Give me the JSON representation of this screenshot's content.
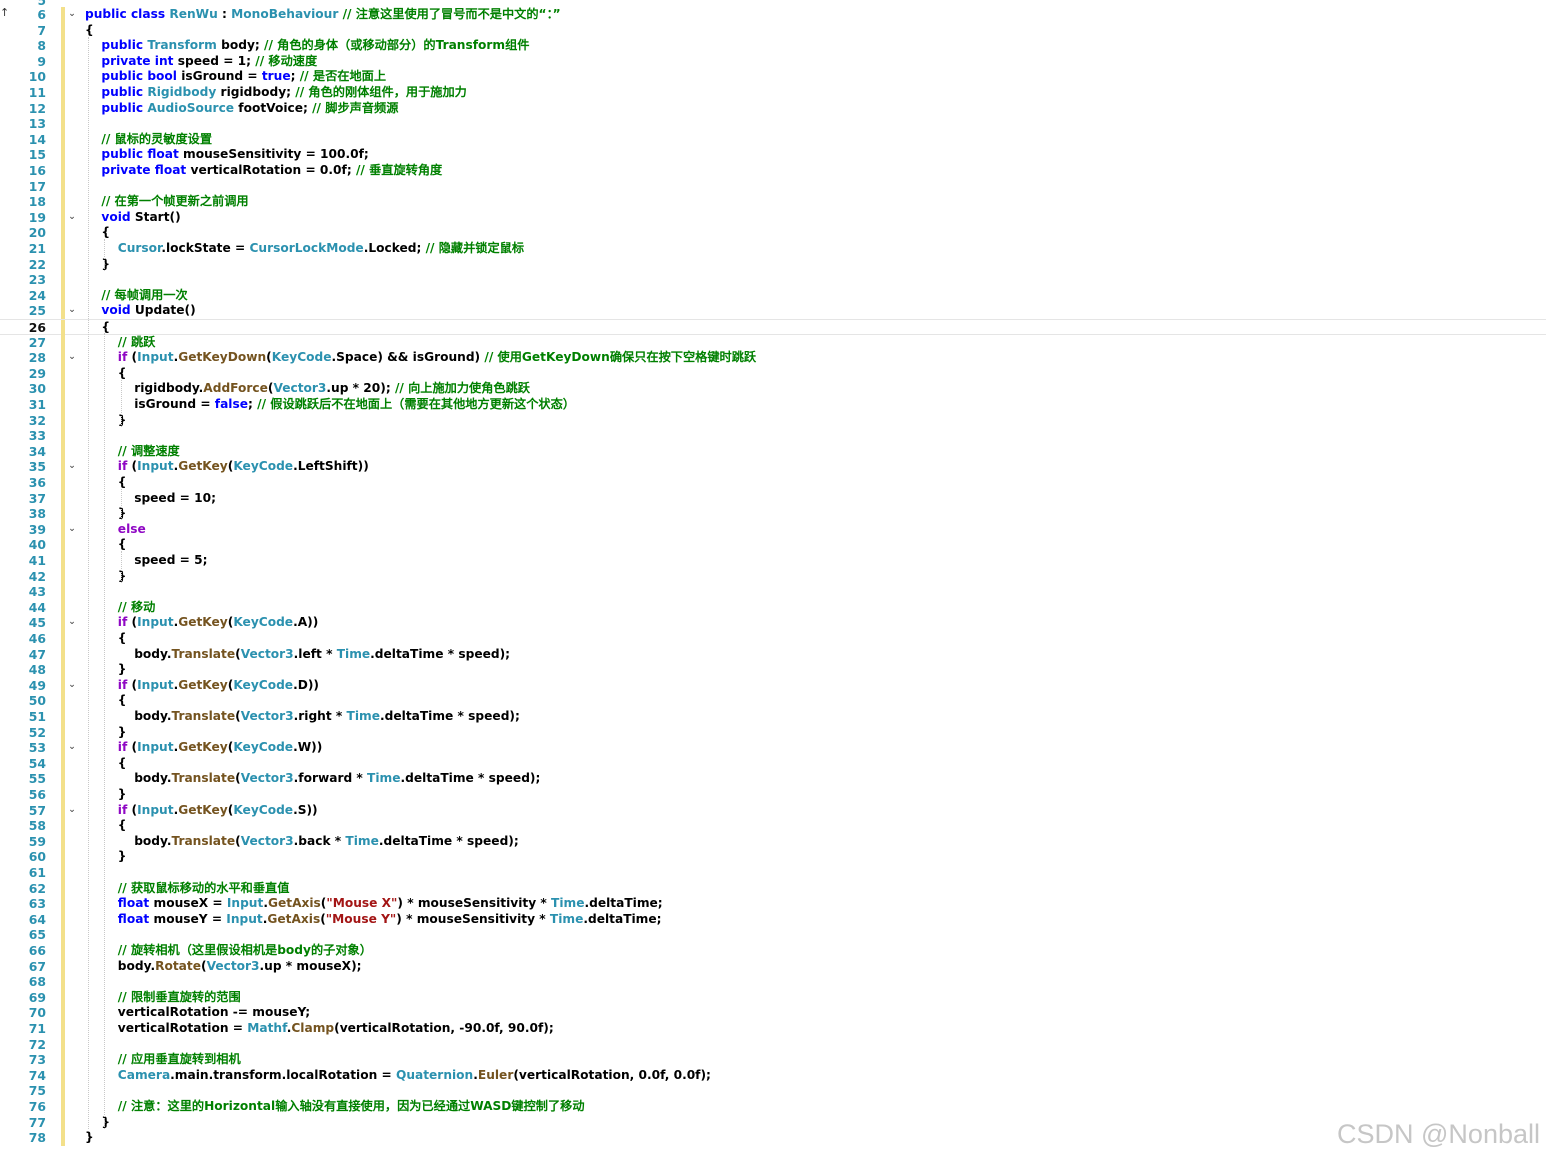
{
  "editor": {
    "top_partial_line": "5",
    "scroll_arrow": "↑",
    "current_line": 26,
    "watermark": "CSDN @Nonball",
    "lines": [
      {
        "n": "6",
        "fold": true,
        "indent": 0,
        "code": [
          {
            "t": "public class ",
            "c": "kw"
          },
          {
            "t": "RenWu",
            "c": "ty"
          },
          {
            "t": " : "
          },
          {
            "t": "MonoBehaviour",
            "c": "ty"
          },
          {
            "t": " // 注意这里使用了冒号而不是中文的“：”",
            "c": "cm"
          }
        ]
      },
      {
        "n": "7",
        "indent": 0,
        "code": [
          {
            "t": "{"
          }
        ]
      },
      {
        "n": "8",
        "indent": 1,
        "code": [
          {
            "t": "public ",
            "c": "kw"
          },
          {
            "t": "Transform",
            "c": "ty"
          },
          {
            "t": " body; "
          },
          {
            "t": "// 角色的身体（或移动部分）的Transform组件",
            "c": "cm"
          }
        ]
      },
      {
        "n": "9",
        "indent": 1,
        "code": [
          {
            "t": "private int ",
            "c": "kw"
          },
          {
            "t": "speed = 1; "
          },
          {
            "t": "// 移动速度",
            "c": "cm"
          }
        ]
      },
      {
        "n": "10",
        "indent": 1,
        "code": [
          {
            "t": "public bool ",
            "c": "kw"
          },
          {
            "t": "isGround = "
          },
          {
            "t": "true",
            "c": "kw"
          },
          {
            "t": "; "
          },
          {
            "t": "// 是否在地面上",
            "c": "cm"
          }
        ]
      },
      {
        "n": "11",
        "indent": 1,
        "code": [
          {
            "t": "public ",
            "c": "kw"
          },
          {
            "t": "Rigidbody",
            "c": "ty"
          },
          {
            "t": " rigidbody; "
          },
          {
            "t": "// 角色的刚体组件，用于施加力",
            "c": "cm"
          }
        ]
      },
      {
        "n": "12",
        "indent": 1,
        "code": [
          {
            "t": "public ",
            "c": "kw"
          },
          {
            "t": "AudioSource",
            "c": "ty"
          },
          {
            "t": " footVoice; "
          },
          {
            "t": "// 脚步声音频源",
            "c": "cm"
          }
        ]
      },
      {
        "n": "13",
        "indent": 1,
        "code": []
      },
      {
        "n": "14",
        "indent": 1,
        "code": [
          {
            "t": "// 鼠标的灵敏度设置",
            "c": "cm"
          }
        ]
      },
      {
        "n": "15",
        "indent": 1,
        "code": [
          {
            "t": "public float ",
            "c": "kw"
          },
          {
            "t": "mouseSensitivity = 100.0f;"
          }
        ]
      },
      {
        "n": "16",
        "indent": 1,
        "code": [
          {
            "t": "private float ",
            "c": "kw"
          },
          {
            "t": "verticalRotation = 0.0f; "
          },
          {
            "t": "// 垂直旋转角度",
            "c": "cm"
          }
        ]
      },
      {
        "n": "17",
        "indent": 1,
        "code": []
      },
      {
        "n": "18",
        "indent": 1,
        "code": [
          {
            "t": "// 在第一个帧更新之前调用",
            "c": "cm"
          }
        ]
      },
      {
        "n": "19",
        "fold": true,
        "indent": 1,
        "code": [
          {
            "t": "void ",
            "c": "kw"
          },
          {
            "t": "Start()"
          }
        ]
      },
      {
        "n": "20",
        "indent": 1,
        "code": [
          {
            "t": "{"
          }
        ]
      },
      {
        "n": "21",
        "indent": 2,
        "code": [
          {
            "t": "Cursor",
            "c": "ty"
          },
          {
            "t": ".lockState = "
          },
          {
            "t": "CursorLockMode",
            "c": "ty"
          },
          {
            "t": ".Locked; "
          },
          {
            "t": "// 隐藏并锁定鼠标",
            "c": "cm"
          }
        ]
      },
      {
        "n": "22",
        "indent": 1,
        "code": [
          {
            "t": "}"
          }
        ]
      },
      {
        "n": "23",
        "indent": 1,
        "code": []
      },
      {
        "n": "24",
        "indent": 1,
        "code": [
          {
            "t": "// 每帧调用一次",
            "c": "cm"
          }
        ]
      },
      {
        "n": "25",
        "fold": true,
        "indent": 1,
        "code": [
          {
            "t": "void ",
            "c": "kw"
          },
          {
            "t": "Update()"
          }
        ]
      },
      {
        "n": "26",
        "indent": 1,
        "code": [
          {
            "t": "{"
          }
        ]
      },
      {
        "n": "27",
        "indent": 2,
        "code": [
          {
            "t": "// 跳跃",
            "c": "cm"
          }
        ]
      },
      {
        "n": "28",
        "fold": true,
        "indent": 2,
        "code": [
          {
            "t": "if ",
            "c": "ctl"
          },
          {
            "t": "("
          },
          {
            "t": "Input",
            "c": "ty"
          },
          {
            "t": "."
          },
          {
            "t": "GetKeyDown",
            "c": "mt"
          },
          {
            "t": "("
          },
          {
            "t": "KeyCode",
            "c": "ty"
          },
          {
            "t": ".Space) && isGround) "
          },
          {
            "t": "// 使用GetKeyDown确保只在按下空格键时跳跃",
            "c": "cm"
          }
        ]
      },
      {
        "n": "29",
        "indent": 2,
        "code": [
          {
            "t": "{"
          }
        ]
      },
      {
        "n": "30",
        "indent": 3,
        "code": [
          {
            "t": "rigidbody."
          },
          {
            "t": "AddForce",
            "c": "mt"
          },
          {
            "t": "("
          },
          {
            "t": "Vector3",
            "c": "ty"
          },
          {
            "t": ".up * 20); "
          },
          {
            "t": "// 向上施加力使角色跳跃",
            "c": "cm"
          }
        ]
      },
      {
        "n": "31",
        "indent": 3,
        "code": [
          {
            "t": "isGround = "
          },
          {
            "t": "false",
            "c": "kw"
          },
          {
            "t": "; "
          },
          {
            "t": "// 假设跳跃后不在地面上（需要在其他地方更新这个状态）",
            "c": "cm"
          }
        ]
      },
      {
        "n": "32",
        "indent": 2,
        "code": [
          {
            "t": "}"
          }
        ]
      },
      {
        "n": "33",
        "indent": 2,
        "code": []
      },
      {
        "n": "34",
        "indent": 2,
        "code": [
          {
            "t": "// 调整速度",
            "c": "cm"
          }
        ]
      },
      {
        "n": "35",
        "fold": true,
        "indent": 2,
        "code": [
          {
            "t": "if ",
            "c": "ctl"
          },
          {
            "t": "("
          },
          {
            "t": "Input",
            "c": "ty"
          },
          {
            "t": "."
          },
          {
            "t": "GetKey",
            "c": "mt"
          },
          {
            "t": "("
          },
          {
            "t": "KeyCode",
            "c": "ty"
          },
          {
            "t": ".LeftShift))"
          }
        ]
      },
      {
        "n": "36",
        "indent": 2,
        "code": [
          {
            "t": "{"
          }
        ]
      },
      {
        "n": "37",
        "indent": 3,
        "code": [
          {
            "t": "speed = 10;"
          }
        ]
      },
      {
        "n": "38",
        "indent": 2,
        "code": [
          {
            "t": "}"
          }
        ]
      },
      {
        "n": "39",
        "fold": true,
        "indent": 2,
        "code": [
          {
            "t": "else",
            "c": "ctl"
          }
        ]
      },
      {
        "n": "40",
        "indent": 2,
        "code": [
          {
            "t": "{"
          }
        ]
      },
      {
        "n": "41",
        "indent": 3,
        "code": [
          {
            "t": "speed = 5;"
          }
        ]
      },
      {
        "n": "42",
        "indent": 2,
        "code": [
          {
            "t": "}"
          }
        ]
      },
      {
        "n": "43",
        "indent": 2,
        "code": []
      },
      {
        "n": "44",
        "indent": 2,
        "code": [
          {
            "t": "// 移动",
            "c": "cm"
          }
        ]
      },
      {
        "n": "45",
        "fold": true,
        "indent": 2,
        "code": [
          {
            "t": "if ",
            "c": "ctl"
          },
          {
            "t": "("
          },
          {
            "t": "Input",
            "c": "ty"
          },
          {
            "t": "."
          },
          {
            "t": "GetKey",
            "c": "mt"
          },
          {
            "t": "("
          },
          {
            "t": "KeyCode",
            "c": "ty"
          },
          {
            "t": ".A))"
          }
        ]
      },
      {
        "n": "46",
        "indent": 2,
        "code": [
          {
            "t": "{"
          }
        ]
      },
      {
        "n": "47",
        "indent": 3,
        "code": [
          {
            "t": "body."
          },
          {
            "t": "Translate",
            "c": "mt"
          },
          {
            "t": "("
          },
          {
            "t": "Vector3",
            "c": "ty"
          },
          {
            "t": ".left * "
          },
          {
            "t": "Time",
            "c": "ty"
          },
          {
            "t": ".deltaTime * speed);"
          }
        ]
      },
      {
        "n": "48",
        "indent": 2,
        "code": [
          {
            "t": "}"
          }
        ]
      },
      {
        "n": "49",
        "fold": true,
        "indent": 2,
        "code": [
          {
            "t": "if ",
            "c": "ctl"
          },
          {
            "t": "("
          },
          {
            "t": "Input",
            "c": "ty"
          },
          {
            "t": "."
          },
          {
            "t": "GetKey",
            "c": "mt"
          },
          {
            "t": "("
          },
          {
            "t": "KeyCode",
            "c": "ty"
          },
          {
            "t": ".D))"
          }
        ]
      },
      {
        "n": "50",
        "indent": 2,
        "code": [
          {
            "t": "{"
          }
        ]
      },
      {
        "n": "51",
        "indent": 3,
        "code": [
          {
            "t": "body."
          },
          {
            "t": "Translate",
            "c": "mt"
          },
          {
            "t": "("
          },
          {
            "t": "Vector3",
            "c": "ty"
          },
          {
            "t": ".right * "
          },
          {
            "t": "Time",
            "c": "ty"
          },
          {
            "t": ".deltaTime * speed);"
          }
        ]
      },
      {
        "n": "52",
        "indent": 2,
        "code": [
          {
            "t": "}"
          }
        ]
      },
      {
        "n": "53",
        "fold": true,
        "indent": 2,
        "code": [
          {
            "t": "if ",
            "c": "ctl"
          },
          {
            "t": "("
          },
          {
            "t": "Input",
            "c": "ty"
          },
          {
            "t": "."
          },
          {
            "t": "GetKey",
            "c": "mt"
          },
          {
            "t": "("
          },
          {
            "t": "KeyCode",
            "c": "ty"
          },
          {
            "t": ".W))"
          }
        ]
      },
      {
        "n": "54",
        "indent": 2,
        "code": [
          {
            "t": "{"
          }
        ]
      },
      {
        "n": "55",
        "indent": 3,
        "code": [
          {
            "t": "body."
          },
          {
            "t": "Translate",
            "c": "mt"
          },
          {
            "t": "("
          },
          {
            "t": "Vector3",
            "c": "ty"
          },
          {
            "t": ".forward * "
          },
          {
            "t": "Time",
            "c": "ty"
          },
          {
            "t": ".deltaTime * speed);"
          }
        ]
      },
      {
        "n": "56",
        "indent": 2,
        "code": [
          {
            "t": "}"
          }
        ]
      },
      {
        "n": "57",
        "fold": true,
        "indent": 2,
        "code": [
          {
            "t": "if ",
            "c": "ctl"
          },
          {
            "t": "("
          },
          {
            "t": "Input",
            "c": "ty"
          },
          {
            "t": "."
          },
          {
            "t": "GetKey",
            "c": "mt"
          },
          {
            "t": "("
          },
          {
            "t": "KeyCode",
            "c": "ty"
          },
          {
            "t": ".S))"
          }
        ]
      },
      {
        "n": "58",
        "indent": 2,
        "code": [
          {
            "t": "{"
          }
        ]
      },
      {
        "n": "59",
        "indent": 3,
        "code": [
          {
            "t": "body."
          },
          {
            "t": "Translate",
            "c": "mt"
          },
          {
            "t": "("
          },
          {
            "t": "Vector3",
            "c": "ty"
          },
          {
            "t": ".back * "
          },
          {
            "t": "Time",
            "c": "ty"
          },
          {
            "t": ".deltaTime * speed);"
          }
        ]
      },
      {
        "n": "60",
        "indent": 2,
        "code": [
          {
            "t": "}"
          }
        ]
      },
      {
        "n": "61",
        "indent": 2,
        "code": []
      },
      {
        "n": "62",
        "indent": 2,
        "code": [
          {
            "t": "// 获取鼠标移动的水平和垂直值",
            "c": "cm"
          }
        ]
      },
      {
        "n": "63",
        "indent": 2,
        "code": [
          {
            "t": "float ",
            "c": "kw"
          },
          {
            "t": "mouseX = "
          },
          {
            "t": "Input",
            "c": "ty"
          },
          {
            "t": "."
          },
          {
            "t": "GetAxis",
            "c": "mt"
          },
          {
            "t": "("
          },
          {
            "t": "\"Mouse X\"",
            "c": "st"
          },
          {
            "t": ") * mouseSensitivity * "
          },
          {
            "t": "Time",
            "c": "ty"
          },
          {
            "t": ".deltaTime;"
          }
        ]
      },
      {
        "n": "64",
        "indent": 2,
        "code": [
          {
            "t": "float ",
            "c": "kw"
          },
          {
            "t": "mouseY = "
          },
          {
            "t": "Input",
            "c": "ty"
          },
          {
            "t": "."
          },
          {
            "t": "GetAxis",
            "c": "mt"
          },
          {
            "t": "("
          },
          {
            "t": "\"Mouse Y\"",
            "c": "st"
          },
          {
            "t": ") * mouseSensitivity * "
          },
          {
            "t": "Time",
            "c": "ty"
          },
          {
            "t": ".deltaTime;"
          }
        ]
      },
      {
        "n": "65",
        "indent": 2,
        "code": []
      },
      {
        "n": "66",
        "indent": 2,
        "code": [
          {
            "t": "// 旋转相机（这里假设相机是body的子对象）",
            "c": "cm"
          }
        ]
      },
      {
        "n": "67",
        "indent": 2,
        "code": [
          {
            "t": "body."
          },
          {
            "t": "Rotate",
            "c": "mt"
          },
          {
            "t": "("
          },
          {
            "t": "Vector3",
            "c": "ty"
          },
          {
            "t": ".up * mouseX);"
          }
        ]
      },
      {
        "n": "68",
        "indent": 2,
        "code": []
      },
      {
        "n": "69",
        "indent": 2,
        "code": [
          {
            "t": "// 限制垂直旋转的范围",
            "c": "cm"
          }
        ]
      },
      {
        "n": "70",
        "indent": 2,
        "code": [
          {
            "t": "verticalRotation -= mouseY;"
          }
        ]
      },
      {
        "n": "71",
        "indent": 2,
        "code": [
          {
            "t": "verticalRotation = "
          },
          {
            "t": "Mathf",
            "c": "ty"
          },
          {
            "t": "."
          },
          {
            "t": "Clamp",
            "c": "mt"
          },
          {
            "t": "(verticalRotation, -90.0f, 90.0f);"
          }
        ]
      },
      {
        "n": "72",
        "indent": 2,
        "code": []
      },
      {
        "n": "73",
        "indent": 2,
        "code": [
          {
            "t": "// 应用垂直旋转到相机",
            "c": "cm"
          }
        ]
      },
      {
        "n": "74",
        "indent": 2,
        "code": [
          {
            "t": "Camera",
            "c": "ty"
          },
          {
            "t": ".main.transform.localRotation = "
          },
          {
            "t": "Quaternion",
            "c": "ty"
          },
          {
            "t": "."
          },
          {
            "t": "Euler",
            "c": "mt"
          },
          {
            "t": "(verticalRotation, 0.0f, 0.0f);"
          }
        ]
      },
      {
        "n": "75",
        "indent": 2,
        "code": []
      },
      {
        "n": "76",
        "indent": 2,
        "code": [
          {
            "t": "// 注意：这里的Horizontal输入轴没有直接使用，因为已经通过WASD键控制了移动",
            "c": "cm"
          }
        ]
      },
      {
        "n": "77",
        "indent": 1,
        "code": [
          {
            "t": "}"
          }
        ]
      },
      {
        "n": "78",
        "indent": 0,
        "code": [
          {
            "t": "}"
          }
        ]
      }
    ],
    "colors": {
      "keyword": "#0000ff",
      "control": "#8f08c4",
      "type": "#2b91af",
      "comment": "#008000",
      "method": "#74531f",
      "string": "#a31515",
      "line_number": "#2b91af"
    }
  }
}
